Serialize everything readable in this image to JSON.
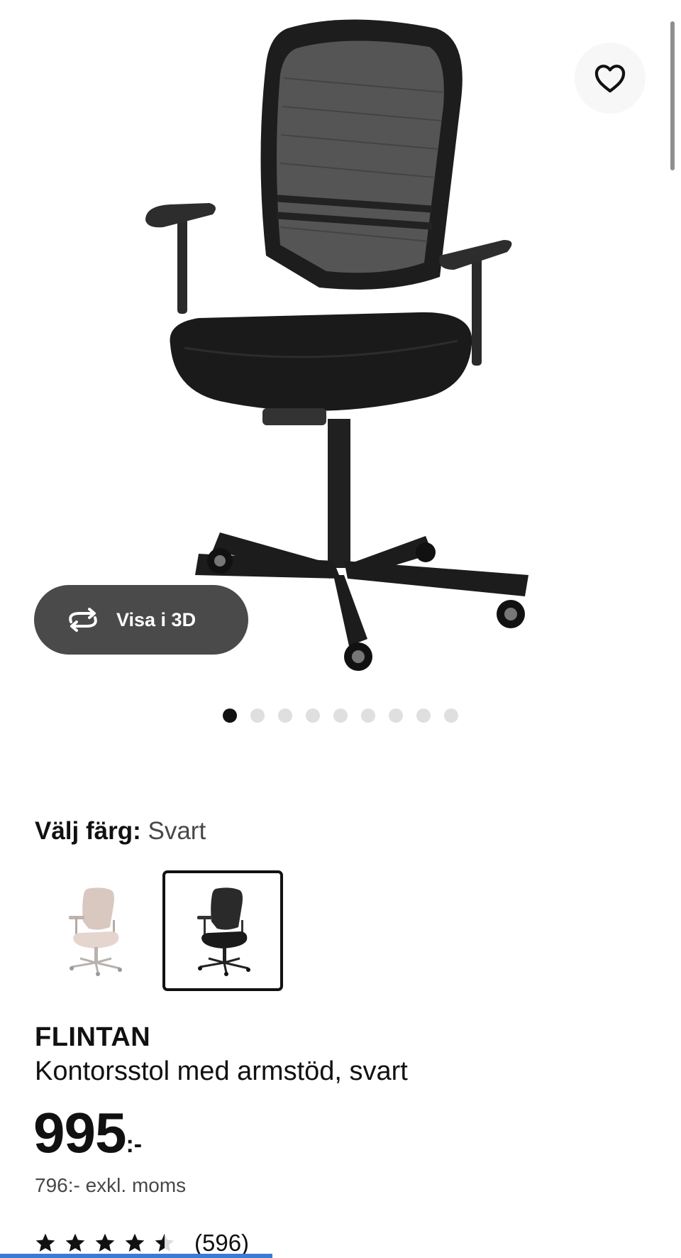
{
  "gallery": {
    "image_alt": "FLINTAN kontorsstol svart",
    "favorite_icon": "heart-icon",
    "view3d": {
      "icon": "rotate-3d-icon",
      "label": "Visa i 3D"
    },
    "image_count": 9,
    "active_image": 1
  },
  "color_select": {
    "label": "Välj färg:",
    "value": "Svart",
    "options": [
      {
        "name": "Beige",
        "selected": false
      },
      {
        "name": "Svart",
        "selected": true
      }
    ]
  },
  "product": {
    "brand": "FLINTAN",
    "description": "Kontorsstol med armstöd, svart",
    "price": "995",
    "price_suffix": ":-",
    "price_excl_vat": "796:- exkl. moms"
  },
  "rating": {
    "stars": 4.5,
    "max_stars": 5,
    "count": "(596)"
  },
  "colors": {
    "text": "#111111",
    "muted": "#484848",
    "button_3d": "#4a4a4a",
    "dot_inactive": "#dfdfdf",
    "progress": "#3a7bd5"
  }
}
